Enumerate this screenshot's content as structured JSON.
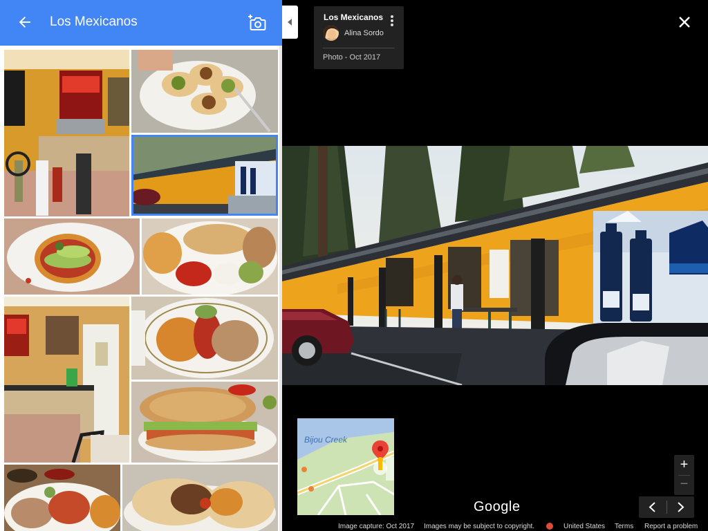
{
  "panel": {
    "title": "Los Mexicanos",
    "back_icon": "arrow-back-icon",
    "add_photo_icon": "add-photo-icon"
  },
  "thumbnails": [
    {
      "name": "interior-soda-fountain",
      "selected": false
    },
    {
      "name": "tacos-plate",
      "selected": false
    },
    {
      "name": "storefront",
      "selected": true
    },
    {
      "name": "tostada-avocado",
      "selected": false
    },
    {
      "name": "combo-plate",
      "selected": false
    },
    {
      "name": "interior-kitchen-door",
      "selected": false
    },
    {
      "name": "rice-beans-plate",
      "selected": false
    },
    {
      "name": "torta-sandwich",
      "selected": false
    },
    {
      "name": "enchilada-plate",
      "selected": false
    },
    {
      "name": "burrito",
      "selected": false
    }
  ],
  "info": {
    "title": "Los Mexicanos",
    "author": "Alina Sordo",
    "date": "Photo - Oct 2017",
    "more_icon": "more-vert-icon"
  },
  "minimap": {
    "creek_label": "Bijou Creek"
  },
  "brand": "Google",
  "footer": {
    "capture": "Image capture: Oct 2017",
    "copyright": "Images may be subject to copyright.",
    "country": "United States",
    "terms": "Terms",
    "report": "Report a problem"
  },
  "colors": {
    "header_blue": "#4285f4",
    "wall_yellow": "#f0a21a",
    "pin_red": "#ea4335"
  }
}
